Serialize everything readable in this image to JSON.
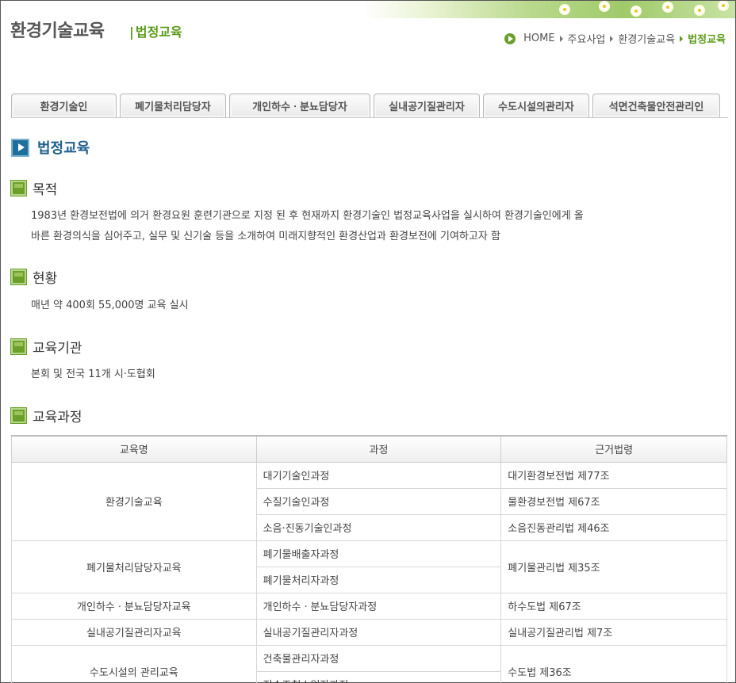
{
  "header": {
    "title": "환경기술교육",
    "subtitle": "법정교육"
  },
  "breadcrumb": {
    "home": "HOME",
    "level1": "주요사업",
    "level2": "환경기술교육",
    "current": "법정교육"
  },
  "tabs": [
    {
      "label": "환경기술인"
    },
    {
      "label": "폐기물처리담당자"
    },
    {
      "label": "개인하수ㆍ분뇨담당자"
    },
    {
      "label": "실내공기질관리자"
    },
    {
      "label": "수도시설의관리자"
    },
    {
      "label": "석면건축물안전관리인"
    }
  ],
  "main_section": {
    "title": "법정교육"
  },
  "sections": {
    "purpose": {
      "title": "목적",
      "line1": "1983년 환경보전법에 의거 환경요원 훈련기관으로 지정 된 후 현재까지 환경기술인 법정교육사업을 실시하여 환경기술인에게 올",
      "line2": "바른 환경의식을 심어주고, 실무 및 신기술 등을 소개하여 미래지향적인 환경산업과 환경보전에 기여하고자 함"
    },
    "status": {
      "title": "현황",
      "text": "매년 약 400회 55,000명 교육 실시"
    },
    "institution": {
      "title": "교육기관",
      "text": "본회 및 전국 11개 시·도협회"
    },
    "courses": {
      "title": "교육과정"
    }
  },
  "table": {
    "headers": [
      "교육명",
      "과정",
      "근거법령"
    ],
    "groups": [
      {
        "name": "환경기술교육",
        "courses": [
          {
            "course": "대기기술인과정",
            "law": "대기환경보전법 제77조"
          },
          {
            "course": "수질기술인과정",
            "law": "물환경보전법 제67조"
          },
          {
            "course": "소음·진동기술인과정",
            "law": "소음진동관리법 제46조"
          }
        ]
      },
      {
        "name": "폐기물처리담당자교육",
        "courses": [
          {
            "course": "폐기물배출자과정"
          },
          {
            "course": "폐기물처리자과정"
          }
        ],
        "law": "폐기물관리법 제35조"
      },
      {
        "name": "개인하수ㆍ분뇨담당자교육",
        "courses": [
          {
            "course": "개인하수ㆍ분뇨담당자과정",
            "law": "하수도법 제67조"
          }
        ]
      },
      {
        "name": "실내공기질관리자교육",
        "courses": [
          {
            "course": "실내공기질관리자과정",
            "law": "실내공기질관리법 제7조"
          }
        ]
      },
      {
        "name": "수도시설의 관리교육",
        "courses": [
          {
            "course": "건축물관리자과정"
          },
          {
            "course": "저수조청소업자과정"
          }
        ],
        "law": "수도법 제36조"
      }
    ]
  }
}
